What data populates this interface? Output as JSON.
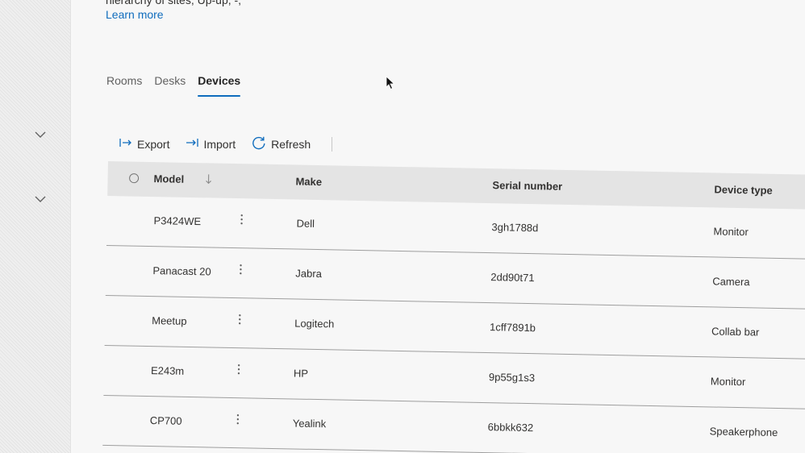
{
  "header": {
    "description_partial": "hierarchy of sites, Up-up, -,",
    "learn_more": "Learn more"
  },
  "tabs": [
    {
      "label": "Rooms",
      "active": false
    },
    {
      "label": "Desks",
      "active": false
    },
    {
      "label": "Devices",
      "active": true
    }
  ],
  "toolbar": {
    "export_label": "Export",
    "import_label": "Import",
    "refresh_label": "Refresh"
  },
  "table": {
    "columns": {
      "model": "Model",
      "make": "Make",
      "serial": "Serial number",
      "device_type": "Device type"
    },
    "rows": [
      {
        "model": "P3424WE",
        "make": "Dell",
        "serial": "3gh1788d",
        "device_type": "Monitor"
      },
      {
        "model": "Panacast 20",
        "make": "Jabra",
        "serial": "2dd90t71",
        "device_type": "Camera"
      },
      {
        "model": "Meetup",
        "make": "Logitech",
        "serial": "1cff7891b",
        "device_type": "Collab bar"
      },
      {
        "model": "E243m",
        "make": "HP",
        "serial": "9p55g1s3",
        "device_type": "Monitor"
      },
      {
        "model": "CP700",
        "make": "Yealink",
        "serial": "6bbkk632",
        "device_type": "Speakerphone"
      }
    ]
  },
  "colors": {
    "accent": "#0f6cbd",
    "header_bg": "#e4e4e4",
    "page_bg": "#f7f7f7"
  },
  "icons": {
    "sidebar": [
      "chevron-down-icon",
      "chevron-down-icon"
    ],
    "toolbar": [
      "export-icon",
      "import-icon",
      "refresh-icon"
    ],
    "table": [
      "select-all-radio-icon",
      "sort-down-arrow-icon",
      "more-vertical-icon"
    ]
  }
}
